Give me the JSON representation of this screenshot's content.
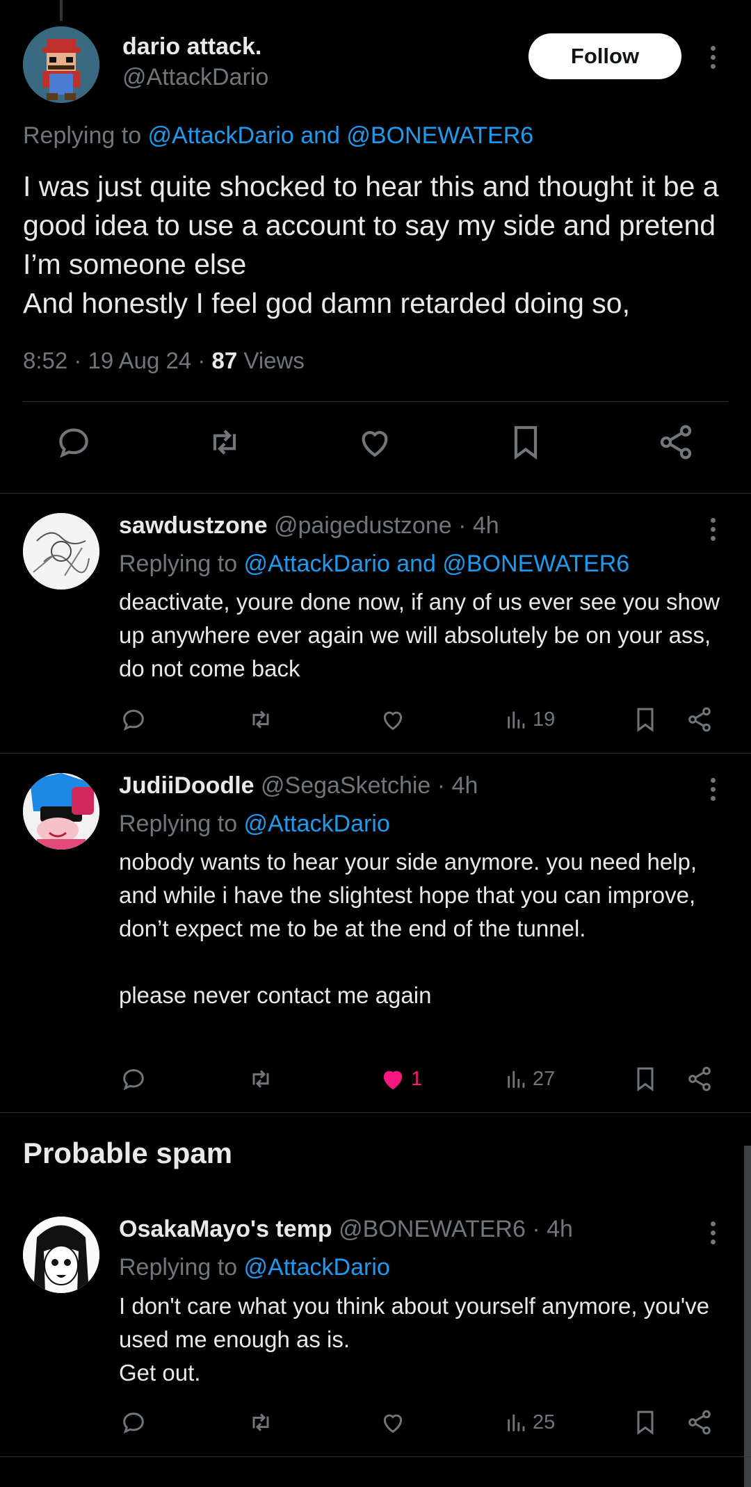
{
  "main_tweet": {
    "author_name": "dario attack.",
    "author_handle": "@AttackDario",
    "follow_label": "Follow",
    "replying_prefix": "Replying to ",
    "replying_mentions": "@AttackDario and @BONEWATER6",
    "text": "I was just quite shocked to hear this and thought it be a good idea to use a account to say my side and pretend I’m someone else\nAnd honestly I feel god damn retarded doing so,",
    "time": "8:52 · 19 Aug 24 · ",
    "views_count": "87",
    "views_label": " Views",
    "actions": [
      "reply-icon",
      "retweet-icon",
      "like-icon",
      "bookmark-icon",
      "share-icon"
    ]
  },
  "replies": [
    {
      "name": "sawdustzone",
      "handle": "@paigedustzone · 4h",
      "replying_prefix": "Replying to ",
      "replying_mentions": "@AttackDario and @BONEWATER6",
      "text": "deactivate, youre done now, if any of us ever see you show up anywhere ever again we will absolutely be on your ass, do not come back",
      "likes": "",
      "views": "19"
    },
    {
      "name": "JudiiDoodle",
      "handle": "@SegaSketchie · 4h",
      "replying_prefix": "Replying to ",
      "replying_mentions": "@AttackDario",
      "text": "nobody wants to hear your side anymore. you need help, and while i have the slightest hope that you can improve, don’t expect me to be at the end of the tunnel.\n\nplease never contact me again",
      "likes": "1",
      "views": "27"
    }
  ],
  "spam_section": {
    "title": "Probable spam",
    "reply": {
      "name": "OsakaMayo's temp",
      "handle": "@BONEWATER6 · 4h",
      "replying_prefix": "Replying to ",
      "replying_mentions": "@AttackDario",
      "text": "I don't care what you think about yourself anymore, you've used me enough as is.\nGet out.",
      "likes": "",
      "views": "25"
    }
  },
  "colors": {
    "background": "#000000",
    "text": "#e7e9ea",
    "muted": "#71767b",
    "link": "#1d9bf0",
    "like": "#f91880",
    "border": "#2f3336"
  }
}
